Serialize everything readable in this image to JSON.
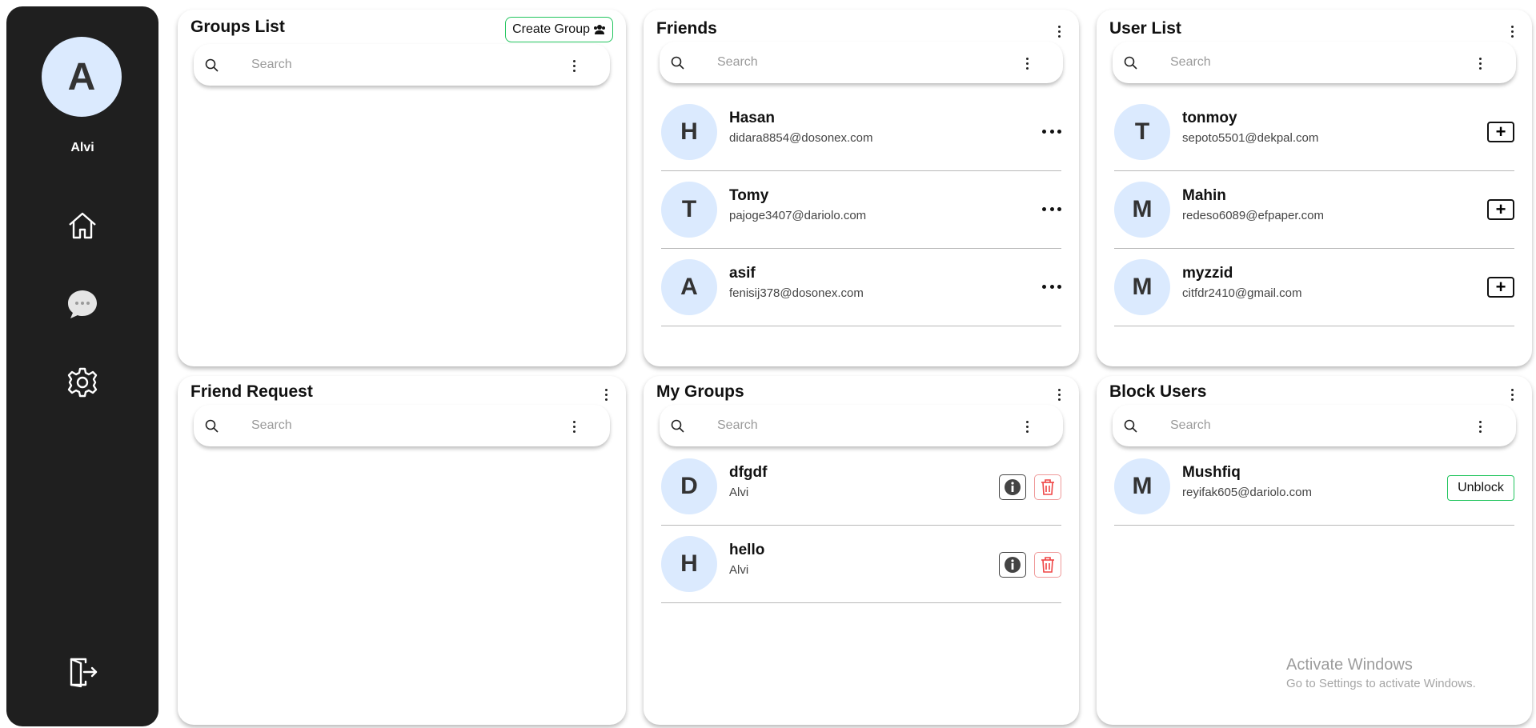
{
  "sidebar": {
    "avatar_letter": "A",
    "username": "Alvi",
    "nav": [
      "home-icon",
      "chat-icon",
      "gear-icon"
    ],
    "logout_icon": "logout-icon"
  },
  "groups_list": {
    "title": "Groups List",
    "create_label": "Create Group",
    "search_placeholder": "Search"
  },
  "friends": {
    "title": "Friends",
    "search_placeholder": "Search",
    "items": [
      {
        "initial": "H",
        "name": "Hasan",
        "email": "didara8854@dosonex.com"
      },
      {
        "initial": "T",
        "name": "Tomy",
        "email": "pajoge3407@dariolo.com"
      },
      {
        "initial": "A",
        "name": "asif",
        "email": "fenisij378@dosonex.com"
      }
    ]
  },
  "user_list": {
    "title": "User List",
    "search_placeholder": "Search",
    "items": [
      {
        "initial": "T",
        "name": "tonmoy",
        "email": "sepoto5501@dekpal.com"
      },
      {
        "initial": "M",
        "name": "Mahin",
        "email": "redeso6089@efpaper.com"
      },
      {
        "initial": "M",
        "name": "myzzid",
        "email": "citfdr2410@gmail.com"
      }
    ]
  },
  "friend_request": {
    "title": "Friend Request",
    "search_placeholder": "Search"
  },
  "my_groups": {
    "title": "My Groups",
    "search_placeholder": "Search",
    "items": [
      {
        "initial": "D",
        "name": "dfgdf",
        "owner": "Alvi"
      },
      {
        "initial": "H",
        "name": "hello",
        "owner": "Alvi"
      }
    ]
  },
  "block_users": {
    "title": "Block Users",
    "search_placeholder": "Search",
    "unblock_label": "Unblock",
    "items": [
      {
        "initial": "M",
        "name": "Mushfiq",
        "email": "reyifak605@dariolo.com"
      }
    ]
  },
  "watermark": {
    "title": "Activate Windows",
    "subtitle": "Go to Settings to activate Windows."
  },
  "colors": {
    "sidebar_bg": "#1f1f1f",
    "avatar_bg": "#dbeafe",
    "accent_green": "#22c55e",
    "delete_red": "#ef4444"
  }
}
